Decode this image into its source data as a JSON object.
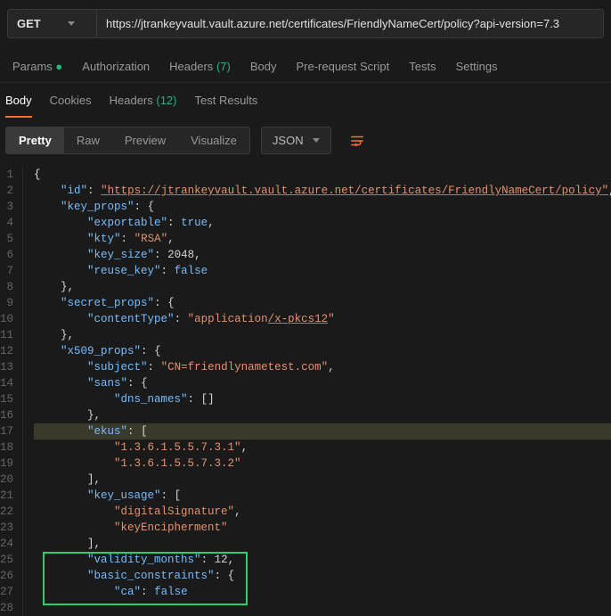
{
  "request": {
    "method": "GET",
    "url": "https://jtrankeyvault.vault.azure.net/certificates/FriendlyNameCert/policy?api-version=7.3"
  },
  "tabs": {
    "params": "Params",
    "authorization": "Authorization",
    "headers": "Headers",
    "headers_count": "(7)",
    "body": "Body",
    "prerequest": "Pre-request Script",
    "tests": "Tests",
    "settings": "Settings"
  },
  "sub_tabs": {
    "body": "Body",
    "cookies": "Cookies",
    "headers": "Headers",
    "headers_count": "(12)",
    "test_results": "Test Results"
  },
  "view_modes": {
    "pretty": "Pretty",
    "raw": "Raw",
    "preview": "Preview",
    "visualize": "Visualize"
  },
  "lang": "JSON",
  "code": {
    "l1_open": "{",
    "l2_key": "\"id\"",
    "l2_val": "\"https://jtrankeyvault.vault.azure.net/certificates/FriendlyNameCert/policy\"",
    "l3_key": "\"key_props\"",
    "l3_val": "{",
    "l4_key": "\"exportable\"",
    "l4_val": "true",
    "l5_key": "\"kty\"",
    "l5_val": "\"RSA\"",
    "l6_key": "\"key_size\"",
    "l6_val": "2048",
    "l7_key": "\"reuse_key\"",
    "l7_val": "false",
    "l8": "}",
    "l9_key": "\"secret_props\"",
    "l9_val": "{",
    "l10_key": "\"contentType\"",
    "l10_val_a": "\"application",
    "l10_val_b": "/x-pkcs12",
    "l10_val_c": "\"",
    "l11": "}",
    "l12_key": "\"x509_props\"",
    "l12_val": "{",
    "l13_key": "\"subject\"",
    "l13_val": "\"CN=friendlynametest.com\"",
    "l14_key": "\"sans\"",
    "l14_val": "{",
    "l15_key": "\"dns_names\"",
    "l15_val": "[]",
    "l16": "}",
    "l17_key": "\"ekus\"",
    "l17_val": "[",
    "l18_val": "\"1.3.6.1.5.5.7.3.1\"",
    "l19_val": "\"1.3.6.1.5.5.7.3.2\"",
    "l20": "]",
    "l21_key": "\"key_usage\"",
    "l21_val": "[",
    "l22_val": "\"digitalSignature\"",
    "l23_val": "\"keyEncipherment\"",
    "l24": "]",
    "l25_key": "\"validity_months\"",
    "l25_val": "12",
    "l26_key": "\"basic_constraints\"",
    "l26_val": "{",
    "l27_key": "\"ca\"",
    "l27_val": "false"
  }
}
